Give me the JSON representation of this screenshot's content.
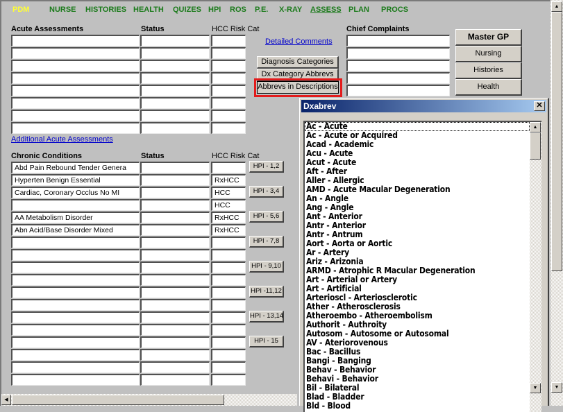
{
  "nav": {
    "items": [
      {
        "label": "PDM",
        "state": "active"
      },
      {
        "label": "NURSE",
        "state": ""
      },
      {
        "label": "HISTORIES",
        "state": ""
      },
      {
        "label": "HEALTH",
        "state": ""
      },
      {
        "label": "QUIZES",
        "state": ""
      },
      {
        "label": "HPI",
        "state": ""
      },
      {
        "label": "ROS",
        "state": ""
      },
      {
        "label": "P.E.",
        "state": ""
      },
      {
        "label": "X-RAY",
        "state": ""
      },
      {
        "label": "ASSESS",
        "state": "current"
      },
      {
        "label": "PLAN",
        "state": ""
      },
      {
        "label": "PROCS",
        "state": ""
      }
    ]
  },
  "acute": {
    "heading": "Acute Assessments",
    "status_heading": "Status",
    "hcc_heading": "HCC Risk Cat",
    "rows": [
      {
        "dx": "",
        "status": "",
        "hcc": ""
      },
      {
        "dx": "",
        "status": "",
        "hcc": ""
      },
      {
        "dx": "",
        "status": "",
        "hcc": ""
      },
      {
        "dx": "",
        "status": "",
        "hcc": ""
      },
      {
        "dx": "",
        "status": "",
        "hcc": ""
      },
      {
        "dx": "",
        "status": "",
        "hcc": ""
      },
      {
        "dx": "",
        "status": "",
        "hcc": ""
      },
      {
        "dx": "",
        "status": "",
        "hcc": ""
      }
    ],
    "additional_link": "Additional Acute Assessments"
  },
  "middle": {
    "detailed_comments_link": "Detailed Comments",
    "diagnosis_categories_btn": "Diagnosis Categories",
    "dx_category_abbrevs_btn": "Dx Category Abbrevs",
    "abbrevs_in_descriptions_btn": "Abbrevs in Descriptions"
  },
  "chief": {
    "heading": "Chief Complaints",
    "values": [
      "",
      "",
      "",
      "",
      ""
    ]
  },
  "right_buttons": [
    "Master GP",
    "Nursing",
    "Histories",
    "Health"
  ],
  "chronic": {
    "heading": "Chronic Conditions",
    "status_heading": "Status",
    "hcc_heading": "HCC Risk Cat",
    "rows": [
      {
        "dx": "Abd Pain Rebound Tender Genera",
        "status": "",
        "hcc": ""
      },
      {
        "dx": "Hyperten  Benign Essential",
        "status": "",
        "hcc": "RxHCC"
      },
      {
        "dx": "Cardiac, Coronary Occlus No MI",
        "status": "",
        "hcc": "HCC"
      },
      {
        "dx": "",
        "status": "",
        "hcc": "HCC"
      },
      {
        "dx": "AA Metabolism Disorder",
        "status": "",
        "hcc": "RxHCC"
      },
      {
        "dx": "Abn Acid/Base Disorder Mixed",
        "status": "",
        "hcc": "RxHCC"
      },
      {
        "dx": "",
        "status": "",
        "hcc": ""
      },
      {
        "dx": "",
        "status": "",
        "hcc": ""
      },
      {
        "dx": "",
        "status": "",
        "hcc": ""
      },
      {
        "dx": "",
        "status": "",
        "hcc": ""
      },
      {
        "dx": "",
        "status": "",
        "hcc": ""
      },
      {
        "dx": "",
        "status": "",
        "hcc": ""
      },
      {
        "dx": "",
        "status": "",
        "hcc": ""
      },
      {
        "dx": "",
        "status": "",
        "hcc": ""
      },
      {
        "dx": "",
        "status": "",
        "hcc": ""
      },
      {
        "dx": "",
        "status": "",
        "hcc": ""
      },
      {
        "dx": "",
        "status": "",
        "hcc": ""
      },
      {
        "dx": "",
        "status": "",
        "hcc": ""
      }
    ],
    "hpi_buttons": [
      "HPI - 1,2",
      "HPI - 3,4",
      "HPI - 5,6",
      "HPI - 7,8",
      "HPI - 9,10",
      "HPI -11,12",
      "HPI - 13,14",
      "HPI - 15"
    ]
  },
  "dialog": {
    "title": "Dxabrev",
    "close_glyph": "✕",
    "selected_index": 0,
    "items": [
      "Ac - Acute",
      "Ac - Acute or Acquired",
      "Acad - Academic",
      "Acu - Acute",
      "Acut - Acute",
      "Aft - After",
      "Aller - Allergic",
      "AMD - Acute Macular Degeneration",
      "An - Angle",
      "Ang - Angle",
      "Ant - Anterior",
      "Antr - Anterior",
      "Antr - Antrum",
      "Aort - Aorta or Aortic",
      "Ar - Artery",
      "Ariz - Arizonia",
      "ARMD - Atrophic R Macular Degeneration",
      "Art - Arterial or Artery",
      "Art - Artificial",
      "Arterioscl - Arteriosclerotic",
      "Ather - Atherosclerosis",
      "Atheroembo - Atheroembolism",
      "Authorit - Authroity",
      "Autosom - Autosome or Autosomal",
      "AV - Ateriorovenous",
      "Bac - Bacillus",
      "Bangi - Banging",
      "Behav - Behavior",
      "Behavi - Behavior",
      "Bil - Bilateral",
      "Blad - Bladder",
      "Bld - Blood"
    ]
  },
  "scroll": {
    "up_glyph": "▲",
    "down_glyph": "▼",
    "left_glyph": "◀"
  }
}
